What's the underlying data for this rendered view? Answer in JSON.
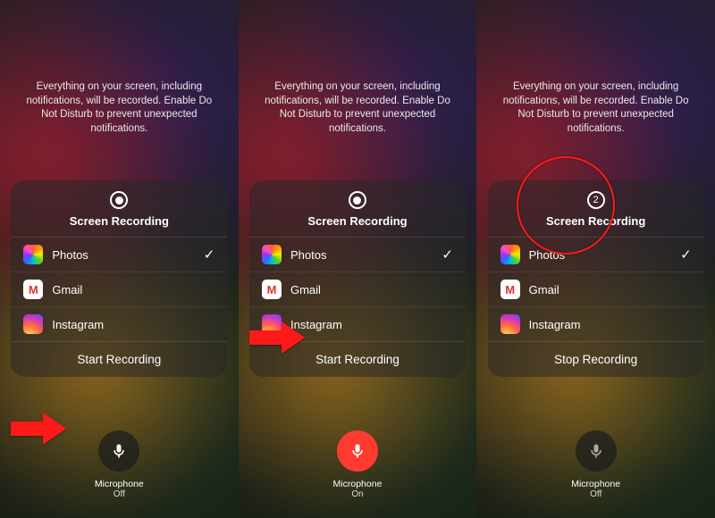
{
  "instruction": "Everything on your screen, including notifications, will be recorded. Enable Do Not Disturb to prevent unexpected notifications.",
  "card_title": "Screen Recording",
  "apps": {
    "photos": "Photos",
    "gmail": "Gmail",
    "instagram": "Instagram"
  },
  "gmail_glyph": "M",
  "actions": {
    "start": "Start Recording",
    "stop": "Stop Recording"
  },
  "mic": {
    "label": "Microphone",
    "off": "Off",
    "on": "On"
  },
  "countdown": "2",
  "check": "✓"
}
